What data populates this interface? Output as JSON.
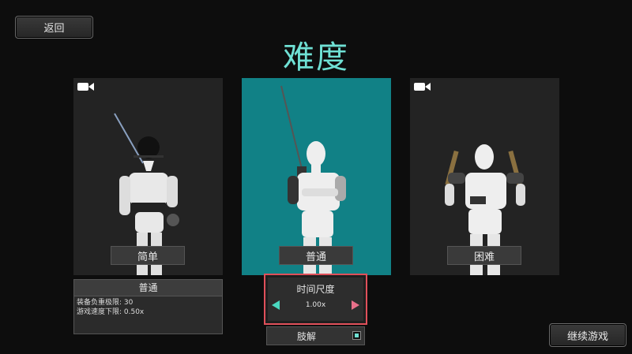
{
  "header": {
    "back_label": "返回",
    "title": "难度"
  },
  "cards": [
    {
      "label": "简单"
    },
    {
      "label": "普通",
      "selected": true
    },
    {
      "label": "困难"
    }
  ],
  "info": {
    "title": "普通",
    "lines": [
      "装备负重极限: 30",
      "游戏速度下限: 0.50x"
    ]
  },
  "time_scale": {
    "title": "时间尺度",
    "value": "1.00x"
  },
  "dismember": {
    "label": "肢解",
    "checked": true
  },
  "footer": {
    "continue_label": "继续游戏"
  },
  "colors": {
    "accent": "#6fe0d4",
    "selected_card": "#118186",
    "highlight": "#e0505a"
  },
  "icons": [
    "video-camera-icon",
    "arrow-left-icon",
    "arrow-right-icon"
  ]
}
